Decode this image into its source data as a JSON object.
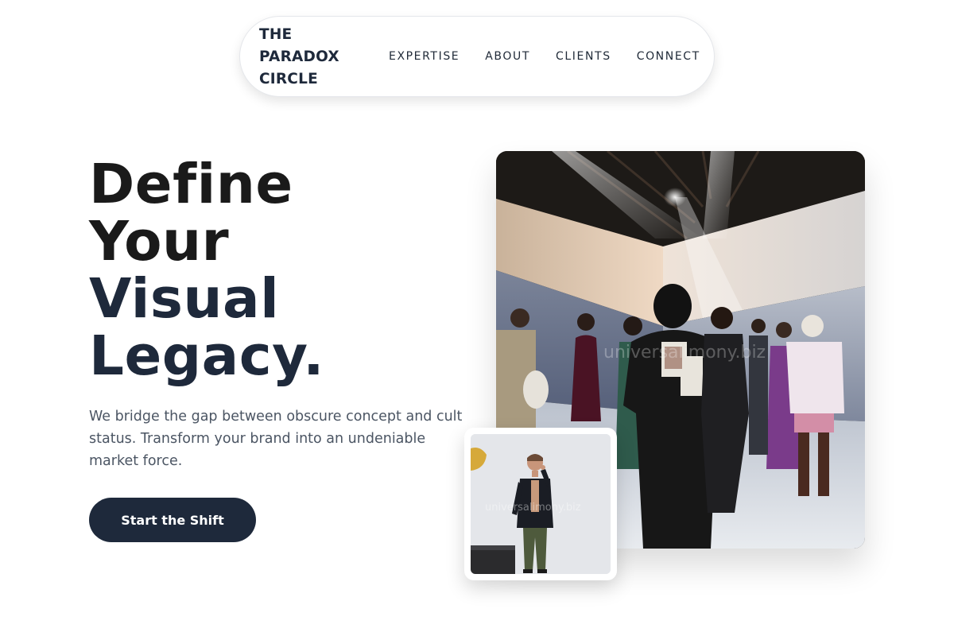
{
  "brand": {
    "lines": [
      "THE",
      "PARADOX",
      "CIRCLE"
    ]
  },
  "nav": {
    "links": [
      {
        "label": "EXPERTISE"
      },
      {
        "label": "ABOUT"
      },
      {
        "label": "CLIENTS"
      },
      {
        "label": "CONNECT"
      }
    ]
  },
  "hero": {
    "headline_lines": [
      "Define",
      "Your",
      "Visual",
      "Legacy."
    ],
    "subcopy": "We bridge the gap between obscure concept and cult status. Transform your brand into an undeniable market force.",
    "cta_label": "Start the Shift"
  },
  "images": {
    "watermark": "universalimony.biz",
    "inset_watermark": "universalimony.biz"
  },
  "colors": {
    "navy": "#1e293b",
    "dark": "#1a1a1a",
    "body_text": "#4b5563"
  }
}
